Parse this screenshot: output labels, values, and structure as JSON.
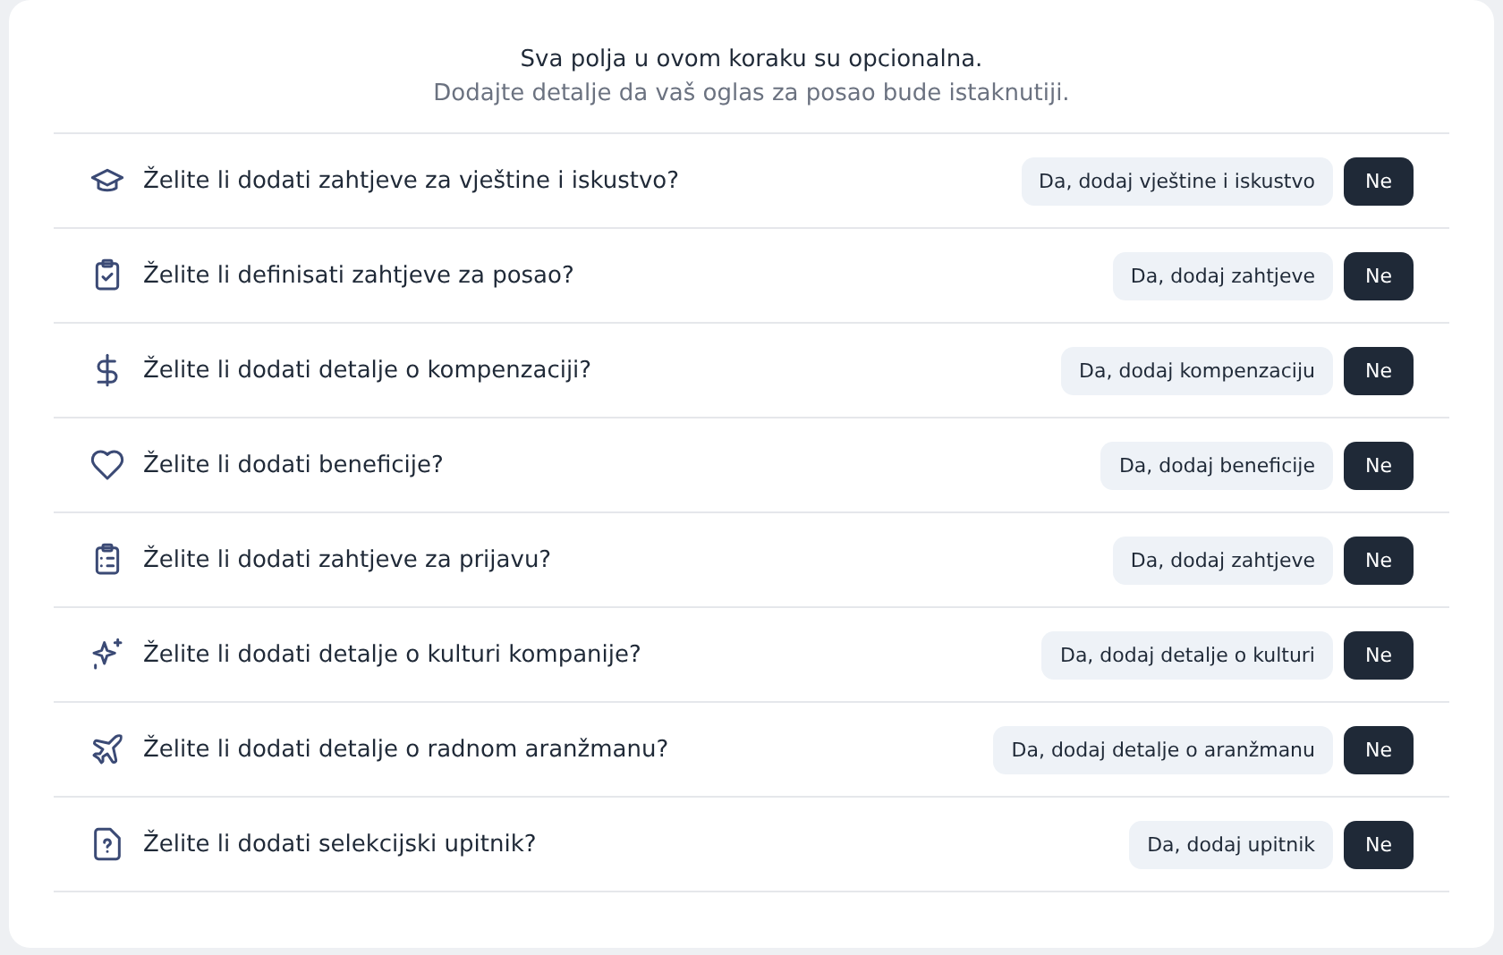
{
  "header": {
    "title": "Sva polja u ovom koraku su opcionalna.",
    "subtitle": "Dodajte detalje da vaš oglas za posao bude istaknutiji."
  },
  "questions": [
    {
      "text": "Želite li dodati zahtjeve za vještine i iskustvo?",
      "yes": {
        "label": "Da, dodaj vještine i iskustvo",
        "selected": false
      },
      "no": {
        "label": "Ne",
        "selected": true
      }
    },
    {
      "text": "Želite li definisati zahtjeve za posao?",
      "yes": {
        "label": "Da, dodaj zahtjeve",
        "selected": false
      },
      "no": {
        "label": "Ne",
        "selected": true
      }
    },
    {
      "text": "Želite li dodati detalje o kompenzaciji?",
      "yes": {
        "label": "Da, dodaj kompenzaciju",
        "selected": false
      },
      "no": {
        "label": "Ne",
        "selected": true
      }
    },
    {
      "text": "Želite li dodati beneficije?",
      "yes": {
        "label": "Da, dodaj beneficije",
        "selected": false
      },
      "no": {
        "label": "Ne",
        "selected": true
      }
    },
    {
      "text": "Želite li dodati zahtjeve za prijavu?",
      "yes": {
        "label": "Da, dodaj zahtjeve",
        "selected": false
      },
      "no": {
        "label": "Ne",
        "selected": true
      }
    },
    {
      "text": "Želite li dodati detalje o kulturi kompanije?",
      "yes": {
        "label": "Da, dodaj detalje o kulturi",
        "selected": false
      },
      "no": {
        "label": "Ne",
        "selected": true
      }
    },
    {
      "text": "Želite li dodati detalje o radnom aranžmanu?",
      "yes": {
        "label": "Da, dodaj detalje o aranžmanu",
        "selected": false
      },
      "no": {
        "label": "Ne",
        "selected": true
      }
    },
    {
      "text": "Želite li dodati selekcijski upitnik?",
      "yes": {
        "label": "Da, dodaj upitnik",
        "selected": false
      },
      "no": {
        "label": "Ne",
        "selected": true
      }
    }
  ]
}
